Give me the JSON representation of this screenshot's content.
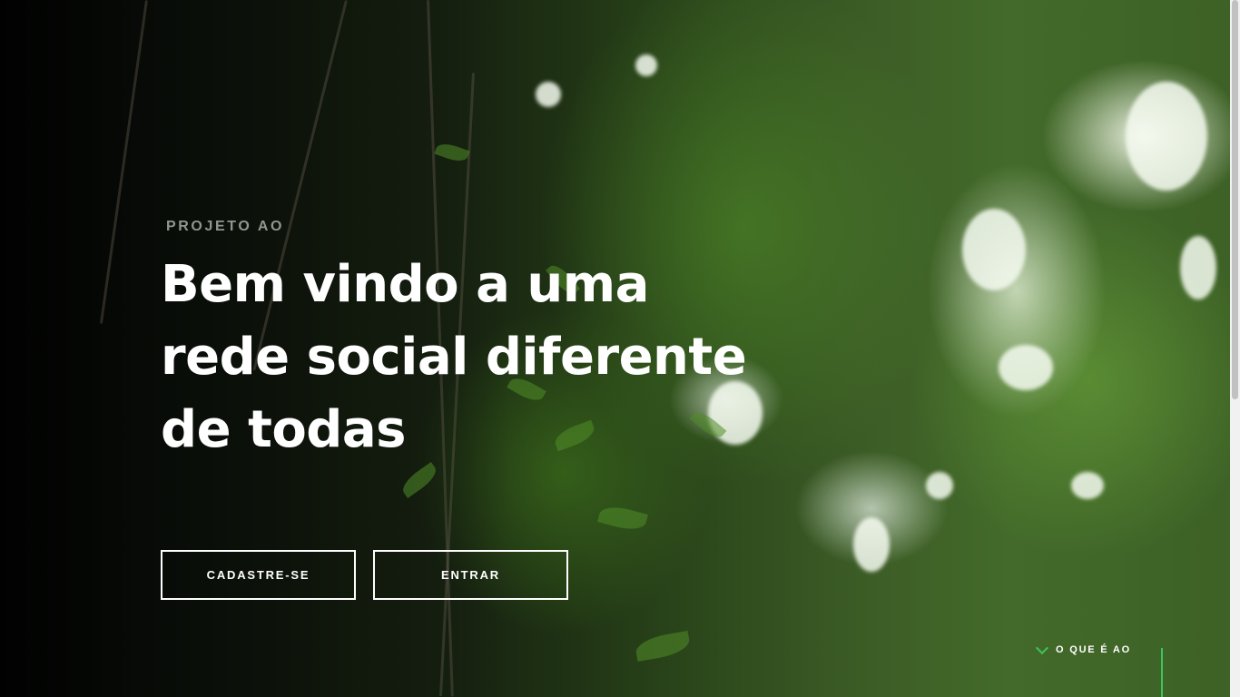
{
  "hero": {
    "eyebrow": "PROJETO AO",
    "headline_lines": [
      "Bem vindo a uma",
      "rede social diferente",
      "de todas"
    ]
  },
  "actions": {
    "signup_label": "CADASTRE-SE",
    "login_label": "ENTRAR"
  },
  "scroll_hint": {
    "label": "O QUE É AO",
    "icon": "chevron-down-icon",
    "accent_color": "#3fc35a"
  },
  "background": {
    "description_icon": "forest-photo"
  }
}
